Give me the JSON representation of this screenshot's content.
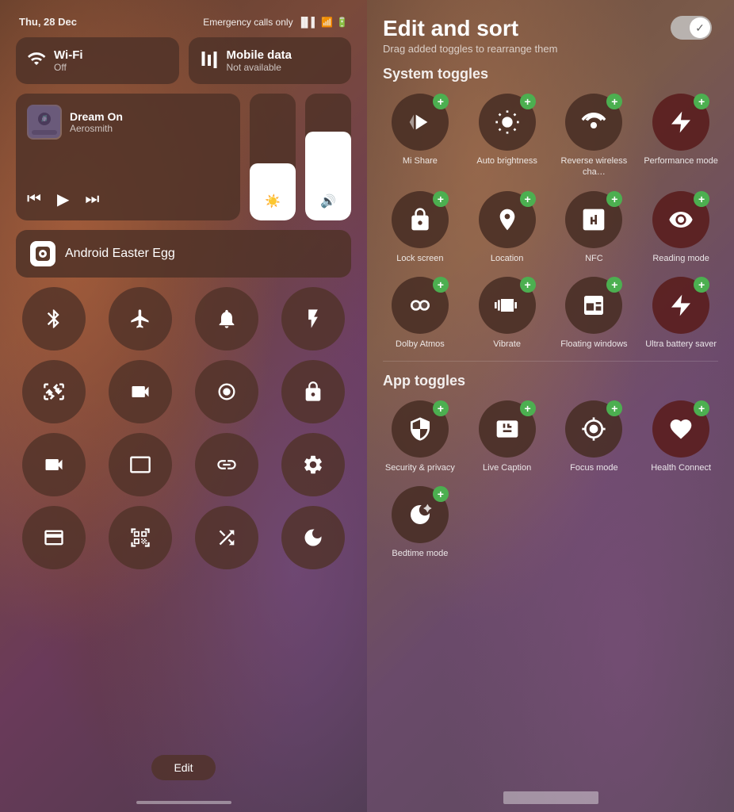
{
  "left": {
    "status_date": "Thu, 28 Dec",
    "emergency_text": "Emergency calls only",
    "network_tiles": [
      {
        "icon": "📶",
        "name": "Wi-Fi",
        "status": "Off",
        "id": "wifi"
      },
      {
        "icon": "↕",
        "name": "Mobile data",
        "status": "Not available",
        "id": "mobile-data"
      }
    ],
    "media": {
      "song": "Dream On",
      "artist": "Aerosmith"
    },
    "brightness_percent": 45,
    "volume_percent": 70,
    "easter_egg_label": "Android Easter Egg",
    "toggles": [
      {
        "id": "bluetooth",
        "unicode": "⚡",
        "label": "Bluetooth"
      },
      {
        "id": "airplane",
        "unicode": "✈",
        "label": "Airplane"
      },
      {
        "id": "bell",
        "unicode": "🔔",
        "label": "Notifications"
      },
      {
        "id": "flashlight",
        "unicode": "🔦",
        "label": "Flashlight"
      },
      {
        "id": "scissors",
        "unicode": "✂",
        "label": "Screenshot"
      },
      {
        "id": "screen-record",
        "unicode": "⊕",
        "label": "Screen record"
      },
      {
        "id": "record",
        "unicode": "⊙",
        "label": "Record"
      },
      {
        "id": "lock",
        "unicode": "🔓",
        "label": "Screen lock"
      },
      {
        "id": "camera",
        "unicode": "📹",
        "label": "Camera"
      },
      {
        "id": "monitor",
        "unicode": "🖥",
        "label": "Screen"
      },
      {
        "id": "link",
        "unicode": "⊕",
        "label": "Link"
      },
      {
        "id": "settings",
        "unicode": "⚙",
        "label": "Settings"
      },
      {
        "id": "card",
        "unicode": "▬",
        "label": "Card"
      },
      {
        "id": "scan",
        "unicode": "⊡",
        "label": "Scan"
      },
      {
        "id": "shuffle",
        "unicode": "⇌",
        "label": "Shuffle"
      },
      {
        "id": "moon",
        "unicode": "🌙",
        "label": "Night mode"
      }
    ],
    "edit_button": "Edit"
  },
  "right": {
    "title": "Edit and sort",
    "subtitle": "Drag added toggles to rearrange them",
    "system_section": "System toggles",
    "app_section": "App toggles",
    "system_toggles": [
      {
        "id": "mi-share",
        "label": "Mi Share",
        "unicode": "≫",
        "dark_red": false
      },
      {
        "id": "auto-brightness",
        "label": "Auto brightness",
        "unicode": "☀",
        "dark_red": false
      },
      {
        "id": "reverse-wireless",
        "label": "Reverse wireless cha…",
        "unicode": "⚡",
        "dark_red": false
      },
      {
        "id": "performance-mode",
        "label": "Performance mode",
        "unicode": "≫",
        "dark_red": true
      },
      {
        "id": "lock-screen",
        "label": "Lock screen",
        "unicode": "🔒",
        "dark_red": false
      },
      {
        "id": "location",
        "label": "Location",
        "unicode": "▷",
        "dark_red": false
      },
      {
        "id": "nfc",
        "label": "NFC",
        "unicode": "N",
        "dark_red": false
      },
      {
        "id": "reading-mode",
        "label": "Reading mode",
        "unicode": "👁",
        "dark_red": true
      },
      {
        "id": "dolby-atmos",
        "label": "Dolby Atmos",
        "unicode": "◗◖",
        "dark_red": false
      },
      {
        "id": "vibrate",
        "label": "Vibrate",
        "unicode": "≋",
        "dark_red": false
      },
      {
        "id": "floating-windows",
        "label": "Floating windows",
        "unicode": "⊡",
        "dark_red": false
      },
      {
        "id": "ultra-battery-saver",
        "label": "Ultra battery saver",
        "unicode": "⚡",
        "dark_red": true
      }
    ],
    "app_toggles": [
      {
        "id": "security-privacy",
        "label": "Security & privacy",
        "unicode": "🛡",
        "dark_red": false
      },
      {
        "id": "live-caption",
        "label": "Live Caption",
        "unicode": "▤",
        "dark_red": false
      },
      {
        "id": "focus-mode",
        "label": "Focus mode",
        "unicode": "◉",
        "dark_red": false
      },
      {
        "id": "health-connect",
        "label": "Health Connect",
        "unicode": "♡",
        "dark_red": true
      },
      {
        "id": "bedtime-mode",
        "label": "Bedtime mode",
        "unicode": "🌙",
        "dark_red": false
      }
    ]
  }
}
